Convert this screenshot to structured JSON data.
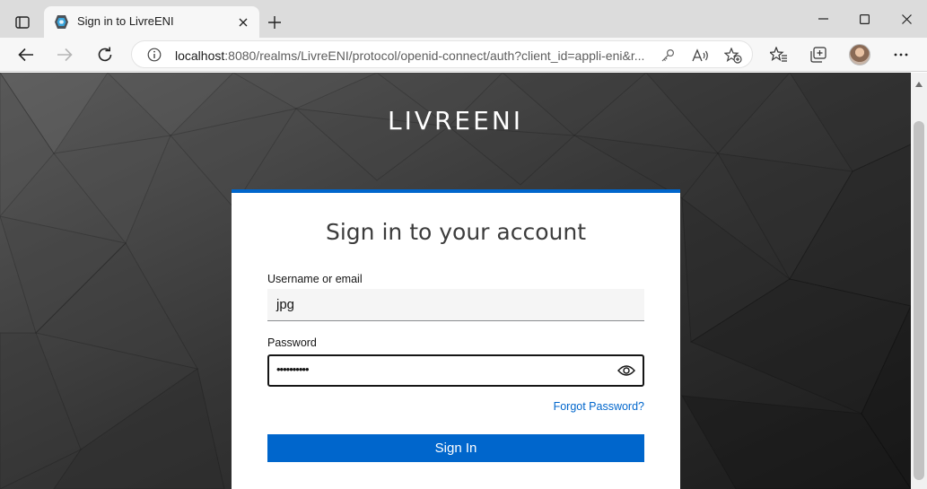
{
  "browser": {
    "tab_title": "Sign in to LivreENI",
    "url_host": "localhost",
    "url_rest": ":8080/realms/LivreENI/protocol/openid-connect/auth?client_id=appli-eni&r..."
  },
  "icons": {
    "sidebar": "sidebar-icon",
    "favicon": "keycloak-icon",
    "tab_close": "close-icon",
    "new_tab": "plus-icon",
    "minimize": "minimize-icon",
    "maximize": "maximize-icon",
    "close_window": "close-icon",
    "back": "back-arrow-icon",
    "forward": "forward-arrow-icon",
    "refresh": "refresh-icon",
    "info": "info-icon",
    "key": "key-icon",
    "read_aloud": "read-aloud-icon",
    "add_favorite": "star-add-icon",
    "favorites": "favorites-icon",
    "collections": "collections-icon",
    "more": "more-icon",
    "show_password": "eye-icon"
  },
  "page": {
    "brand": "LIVREENI",
    "title": "Sign in to your account",
    "username_label": "Username or email",
    "username_value": "jpg",
    "password_label": "Password",
    "password_value": "••••••••••",
    "forgot_link": "Forgot Password?",
    "signin_button": "Sign In"
  },
  "colors": {
    "accent": "#0066cc",
    "background_dark": "#2b2b2b"
  }
}
